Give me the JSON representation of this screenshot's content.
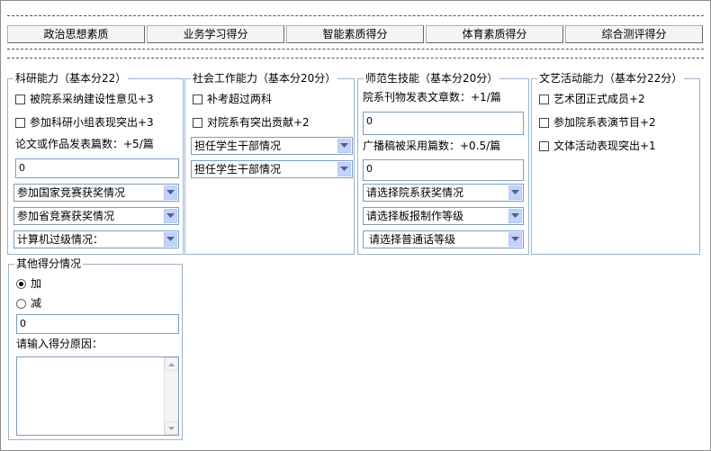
{
  "tabs": [
    "政治思想素质",
    "业务学习得分",
    "智能素质得分",
    "体育素质得分",
    "综合测评得分"
  ],
  "research": {
    "legend": "科研能力（基本分22）",
    "check1": "被院系采纳建设性意见+3",
    "check2": "参加科研小组表现突出+3",
    "papers_label": "论文或作品发表篇数：+5/篇",
    "papers_value": "0",
    "select_national": "参加国家竞赛获奖情况",
    "select_provincial": "参加省竞赛获奖情况",
    "select_computer": "计算机过级情况："
  },
  "social": {
    "legend": "社会工作能力（基本分20分）",
    "check1": "补考超过两科",
    "check2": "对院系有突出贡献+2",
    "select1": "担任学生干部情况",
    "select2": "担任学生干部情况"
  },
  "normal": {
    "legend": "师范生技能（基本分20分）",
    "articles_label": "院系刊物发表文章数：+1/篇",
    "articles_value": "0",
    "broadcast_label": "广播稿被采用篇数：+0.5/篇",
    "broadcast_value": "0",
    "select_award": "请选择院系获奖情况",
    "select_board": "请选择板报制作等级",
    "select_mandarin": "请选择普通话等级"
  },
  "arts": {
    "legend": "文艺活动能力（基本分22分）",
    "check1": "艺术团正式成员+2",
    "check2": "参加院系表演节目+2",
    "check3": "文体活动表现突出+1"
  },
  "other": {
    "legend": "其他得分情况",
    "radio_add": "加",
    "radio_sub": "减",
    "score_value": "0",
    "reason_label": "请输入得分原因："
  }
}
